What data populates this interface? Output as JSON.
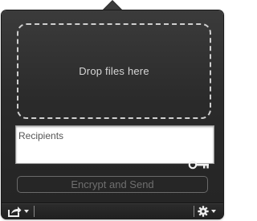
{
  "dropzone": {
    "label": "Drop files here"
  },
  "recipients": {
    "placeholder": "Recipients",
    "value": ""
  },
  "actions": {
    "encrypt_label": "Encrypt and Send",
    "encrypt_enabled": false
  },
  "icons": {
    "key": "key-icon",
    "share": "share-icon",
    "gear": "gear-icon",
    "dropdown": "chevron-down-icon"
  },
  "colors": {
    "panel": "#2a2a2a",
    "dropzone_border": "#cfcfcf",
    "disabled_text": "#6f6f6f"
  }
}
